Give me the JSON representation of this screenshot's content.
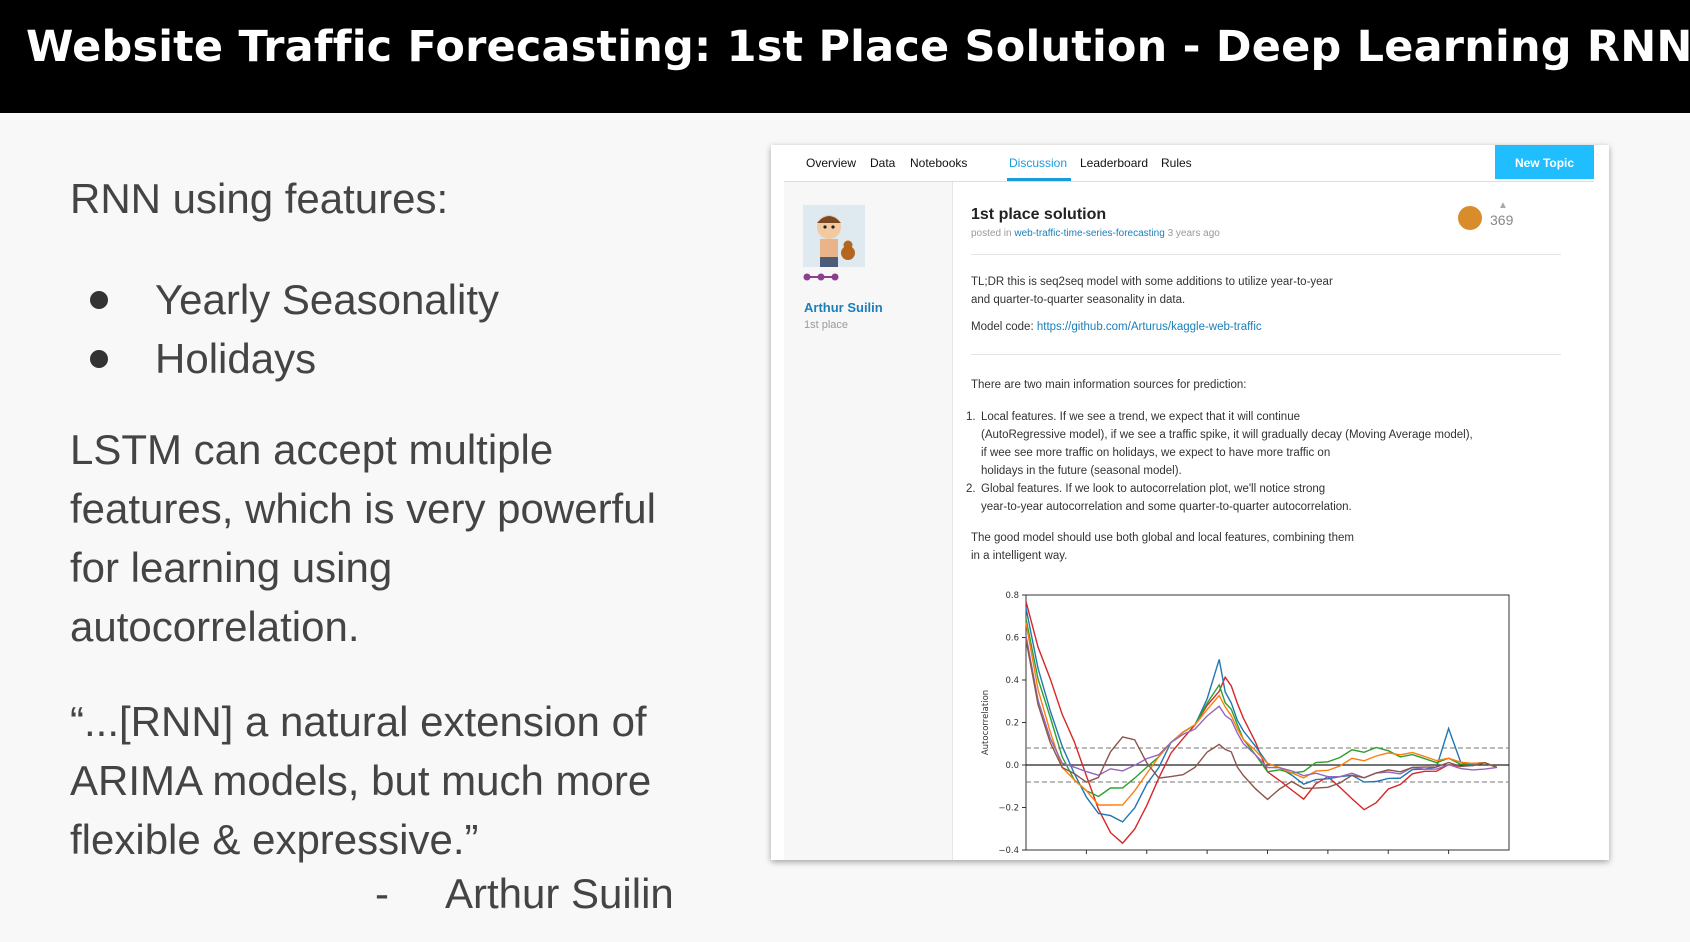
{
  "slide": {
    "title": "Website Traffic Forecasting: 1st Place Solution - Deep Learning RNN",
    "rnn_heading": "RNN using features:",
    "bullets": [
      "Yearly Seasonality",
      "Holidays"
    ],
    "lstm_lines": [
      "LSTM can accept multiple",
      "features, which is very powerful",
      "for learning using",
      "autocorrelation."
    ],
    "quote_lines": [
      "“...[RNN] a natural extension of",
      "ARIMA models, but much more",
      "flexible & expressive.”"
    ],
    "attribution_dash": "-",
    "attribution": "Arthur Suilin"
  },
  "kaggle": {
    "tabs": [
      "Overview",
      "Data",
      "Notebooks",
      "Discussion",
      "Leaderboard",
      "Rules"
    ],
    "active_tab": "Discussion",
    "new_topic_label": "New Topic",
    "author": "Arthur Suilin",
    "author_rank": "1st place",
    "post_title": "1st place solution",
    "posted_prefix": "posted in",
    "posted_link": "web-traffic-time-series-forecasting",
    "posted_time": "3 years ago",
    "votes": "369",
    "tldr_1": "TL;DR this is seq2seq model with some additions to utilize year-to-year",
    "tldr_2": "and quarter-to-quarter seasonality in data.",
    "model_code_label": "Model code:",
    "model_code_link": "https://github.com/Arturus/kaggle-web-traffic",
    "sources_intro": "There are two main information sources for prediction:",
    "item1_num": "1.",
    "item1_lines": [
      "Local features. If we see a trend, we expect that it will continue",
      "(AutoRegressive model), if we see a traffic spike, it will gradually decay (Moving Average model),",
      "if wee see more traffic on holidays, we expect to have more traffic on",
      "holidays in the future (seasonal model)."
    ],
    "item2_num": "2.",
    "item2_lines": [
      "Global features. If we look to autocorrelation plot, we'll notice strong",
      "year-to-year autocorrelation and some quarter-to-quarter autocorrelation."
    ],
    "conclusion_1": "The good model should use both global and local features, combining them",
    "conclusion_2": "in a intelligent way."
  },
  "chart_data": {
    "type": "line",
    "ylabel": "Autocorrelation",
    "xlabel": "",
    "ylim": [
      -0.4,
      0.8
    ],
    "yticks": [
      "0.8",
      "0.6",
      "0.4",
      "0.2",
      "0.0",
      "−0.2",
      "−0.4"
    ],
    "xlim": [
      0,
      800
    ],
    "reference_lines": [
      0.08,
      0.0,
      -0.08
    ],
    "x": [
      0,
      20,
      40,
      60,
      80,
      100,
      120,
      140,
      160,
      180,
      200,
      220,
      240,
      260,
      280,
      300,
      320,
      330,
      340,
      350,
      360,
      380,
      400,
      420,
      440,
      460,
      480,
      500,
      520,
      540,
      560,
      580,
      600,
      620,
      640,
      660,
      680,
      700,
      720,
      740,
      760,
      780
    ],
    "series": [
      {
        "color": "#d62728",
        "values": [
          0.78,
          0.55,
          0.4,
          0.25,
          0.1,
          -0.05,
          -0.2,
          -0.33,
          -0.36,
          -0.3,
          -0.2,
          -0.05,
          0.05,
          0.12,
          0.2,
          0.27,
          0.35,
          0.42,
          0.36,
          0.3,
          0.22,
          0.1,
          -0.02,
          -0.08,
          -0.12,
          -0.15,
          -0.1,
          -0.05,
          -0.1,
          -0.17,
          -0.2,
          -0.18,
          -0.12,
          -0.08,
          -0.05,
          -0.03,
          -0.02,
          -0.01,
          0.0,
          0.01,
          0.0,
          0.0
        ]
      },
      {
        "color": "#1f77b4",
        "values": [
          0.75,
          0.45,
          0.25,
          0.1,
          -0.05,
          -0.15,
          -0.22,
          -0.25,
          -0.26,
          -0.2,
          -0.1,
          0.0,
          0.1,
          0.15,
          0.2,
          0.3,
          0.5,
          0.35,
          0.28,
          0.22,
          0.16,
          0.08,
          0.02,
          -0.02,
          -0.05,
          -0.08,
          -0.08,
          -0.06,
          -0.05,
          -0.06,
          -0.07,
          -0.08,
          -0.07,
          -0.05,
          -0.03,
          -0.02,
          0.0,
          0.16,
          0.02,
          0.0,
          0.0,
          0.0
        ]
      },
      {
        "color": "#2ca02c",
        "values": [
          0.7,
          0.4,
          0.22,
          0.05,
          -0.08,
          -0.12,
          -0.14,
          -0.12,
          -0.1,
          -0.06,
          -0.02,
          0.05,
          0.1,
          0.15,
          0.2,
          0.28,
          0.38,
          0.3,
          0.25,
          0.2,
          0.12,
          0.04,
          -0.02,
          -0.03,
          -0.04,
          -0.02,
          0.0,
          0.02,
          0.04,
          0.06,
          0.07,
          0.08,
          0.06,
          0.05,
          0.04,
          0.03,
          0.02,
          0.02,
          0.01,
          0.01,
          0.0,
          0.0
        ]
      },
      {
        "color": "#ff7f0e",
        "values": [
          0.68,
          0.35,
          0.15,
          0.0,
          -0.08,
          -0.12,
          -0.18,
          -0.2,
          -0.18,
          -0.12,
          -0.05,
          0.05,
          0.1,
          0.15,
          0.2,
          0.25,
          0.33,
          0.28,
          0.22,
          0.18,
          0.12,
          0.06,
          0.02,
          -0.02,
          -0.04,
          -0.05,
          -0.04,
          -0.02,
          0.0,
          0.02,
          0.03,
          0.04,
          0.05,
          0.06,
          0.05,
          0.04,
          0.03,
          0.02,
          0.02,
          0.01,
          0.0,
          0.0
        ]
      },
      {
        "color": "#9467bd",
        "values": [
          0.62,
          0.3,
          0.12,
          0.02,
          -0.02,
          -0.03,
          -0.04,
          -0.03,
          -0.02,
          0.0,
          0.02,
          0.06,
          0.1,
          0.14,
          0.18,
          0.22,
          0.28,
          0.24,
          0.2,
          0.16,
          0.1,
          0.04,
          0.0,
          -0.02,
          -0.03,
          -0.04,
          -0.05,
          -0.05,
          -0.05,
          -0.05,
          -0.05,
          -0.04,
          -0.04,
          -0.03,
          -0.02,
          -0.02,
          -0.01,
          -0.01,
          -0.01,
          -0.02,
          -0.03,
          0.0
        ]
      },
      {
        "color": "#8c564b",
        "values": [
          0.6,
          0.28,
          0.1,
          0.0,
          -0.05,
          -0.08,
          -0.05,
          0.05,
          0.14,
          0.12,
          0.0,
          -0.05,
          -0.06,
          -0.05,
          0.0,
          0.05,
          0.1,
          0.08,
          0.05,
          0.0,
          -0.05,
          -0.12,
          -0.15,
          -0.12,
          -0.08,
          -0.1,
          -0.12,
          -0.1,
          -0.08,
          -0.06,
          -0.05,
          -0.04,
          -0.03,
          -0.02,
          -0.02,
          -0.01,
          0.0,
          0.0,
          0.0,
          0.0,
          0.0,
          0.0
        ]
      }
    ]
  }
}
